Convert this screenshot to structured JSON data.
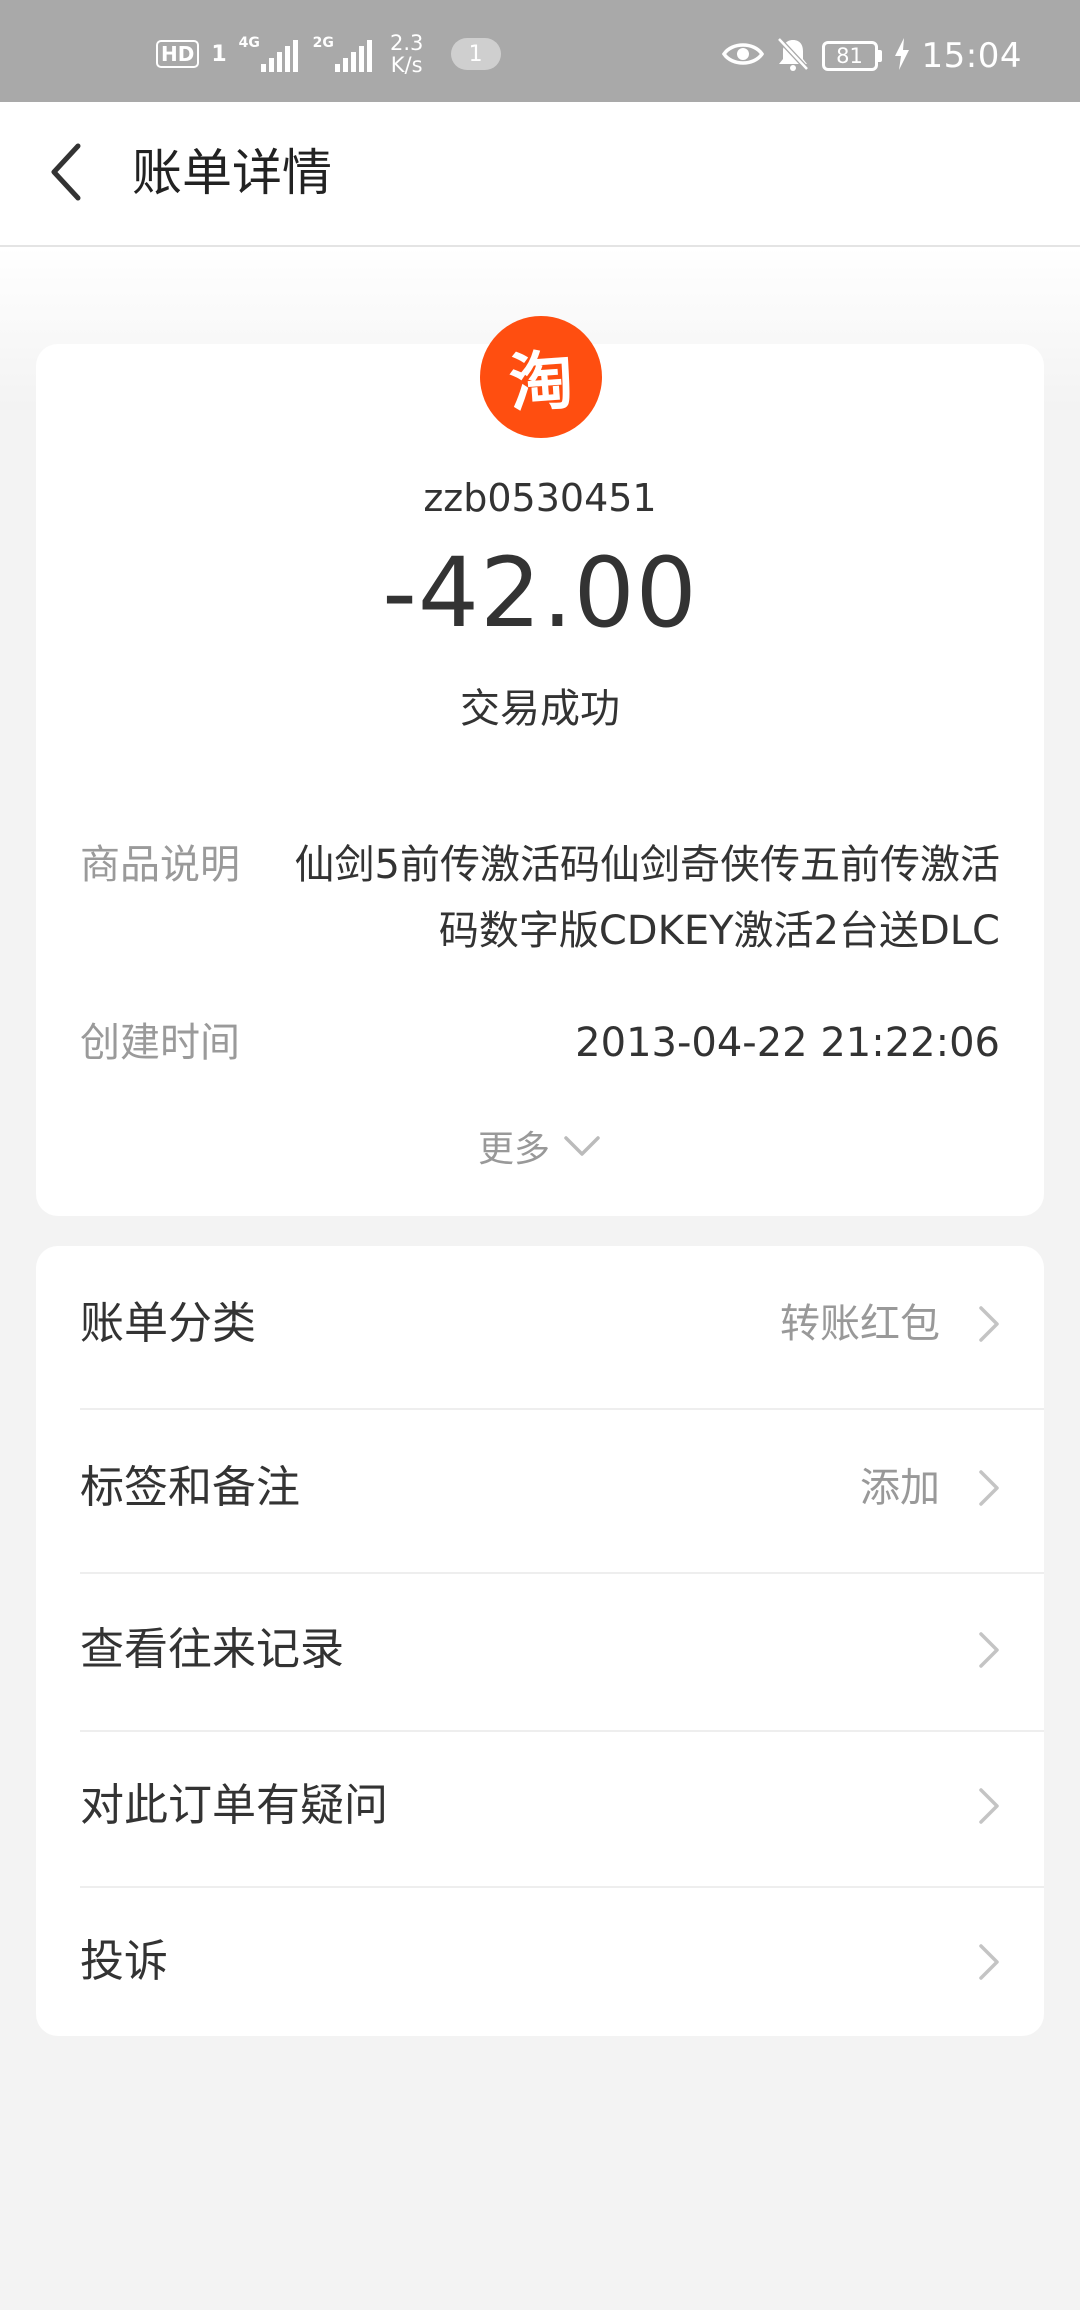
{
  "status_bar": {
    "hd_label": "HD",
    "sim_label": "1",
    "network_1": "4G",
    "network_2": "2G",
    "speed_value": "2.3",
    "speed_unit": "K/s",
    "notification_count": "1",
    "battery_level": "81",
    "time": "15:04",
    "icons": [
      "eye-icon",
      "bell-muted-icon",
      "battery-icon",
      "charging-icon"
    ]
  },
  "header": {
    "back_icon": "chevron-left-icon",
    "title": "账单详情"
  },
  "bill": {
    "logo_icon": "taobao-icon",
    "logo_char": "淘",
    "merchant": "zzb0530451",
    "amount": "-42.00",
    "status": "交易成功",
    "description_label": "商品说明",
    "description_value": "仙剑5前传激活码仙剑奇侠传五前传激活码数字版CDKEY激活2台送DLC",
    "created_label": "创建时间",
    "created_value": "2013-04-22 21:22:06",
    "more_label": "更多"
  },
  "list": {
    "items": [
      {
        "label": "账单分类",
        "value": "转账红包"
      },
      {
        "label": "标签和备注",
        "value": "添加"
      },
      {
        "label": "查看往来记录",
        "value": ""
      },
      {
        "label": "对此订单有疑问",
        "value": ""
      },
      {
        "label": "投诉",
        "value": ""
      }
    ]
  },
  "colors": {
    "status_bar_bg": "#a9a9a9",
    "brand_orange": "#ff4e10",
    "page_bg": "#f3f3f3"
  }
}
